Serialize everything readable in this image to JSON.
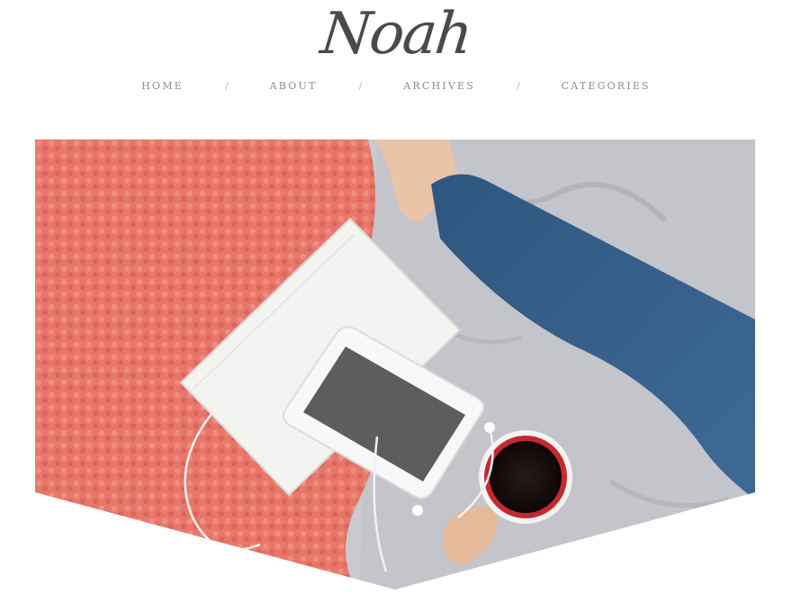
{
  "header": {
    "logo_text": "Noah"
  },
  "nav": {
    "items": [
      {
        "label": "HOME"
      },
      {
        "label": "ABOUT"
      },
      {
        "label": "ARCHIVES"
      },
      {
        "label": "CATEGORIES"
      }
    ],
    "separator": "/"
  },
  "colors": {
    "blanket": "#e8776a",
    "sheets": "#c9c9cf",
    "denim": "#355a80",
    "screen": "#5f5c5c",
    "coffee": "#1a0f10",
    "mug": "#c22a2f"
  }
}
